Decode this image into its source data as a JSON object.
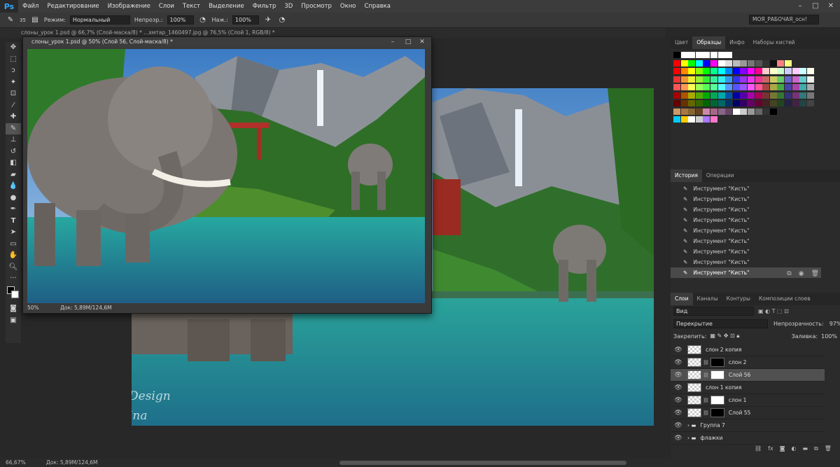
{
  "app": {
    "logo": "Ps"
  },
  "menu": [
    "Файл",
    "Редактирование",
    "Изображение",
    "Слои",
    "Текст",
    "Выделение",
    "Фильтр",
    "3D",
    "Просмотр",
    "Окно",
    "Справка"
  ],
  "workspace": "МОЯ_РАБОЧАЯ_осн!",
  "options": {
    "brush_size": "35",
    "mode_label": "Режим:",
    "mode_value": "Нормальный",
    "opacity_label": "Непрозр.:",
    "opacity_value": "100%",
    "flow_label": "Наж.:",
    "flow_value": "100%"
  },
  "tabs": "слоны_урок 1.psd @ 66,7% (Слой-маска/8) *     ...хмтар_1460497.jpg @ 76,5% (Слой 1, RGB/8) *",
  "float_doc": {
    "title": "слоны_урок 1.psd @ 50% (Слой 56, Слой-маска/8) *",
    "zoom": "50%",
    "doc_size": "Док: 5,89M/124,6M"
  },
  "bg_doc": {
    "watermark1": "Design",
    "watermark2": "ina"
  },
  "swatches_panel": {
    "tabs": [
      "Цвет",
      "Образцы",
      "Инфо",
      "Наборы кистей"
    ],
    "active": "Образцы"
  },
  "history_panel": {
    "tabs": [
      "История",
      "Операции"
    ],
    "items": [
      "Инструмент \"Кисть\"",
      "Инструмент \"Кисть\"",
      "Инструмент \"Кисть\"",
      "Инструмент \"Кисть\"",
      "Инструмент \"Кисть\"",
      "Инструмент \"Кисть\"",
      "Инструмент \"Кисть\"",
      "Инструмент \"Кисть\"",
      "Инструмент \"Кисть\""
    ]
  },
  "layers_panel": {
    "tabs": [
      "Слои",
      "Каналы",
      "Контуры",
      "Композиции слоев"
    ],
    "filter": "Вид",
    "blend": "Перекрытие",
    "opacity_label": "Непрозрачность:",
    "opacity_value": "97%",
    "lock_label": "Закрепить:",
    "fill_label": "Заливка:",
    "fill_value": "100%",
    "layers": [
      {
        "name": "слон 2 копия",
        "mask": "none"
      },
      {
        "name": "слон 2",
        "mask": "black"
      },
      {
        "name": "Слой 56",
        "mask": "white"
      },
      {
        "name": "слон 1 копия",
        "mask": "none"
      },
      {
        "name": "слон 1",
        "mask": "white"
      },
      {
        "name": "Слой 55",
        "mask": "black"
      },
      {
        "name": "Группа 7",
        "mask": "group"
      },
      {
        "name": "флажки",
        "mask": "group"
      }
    ]
  },
  "status": {
    "zoom": "66,67%",
    "doc_size": "Док: 5,89M/124,6M"
  }
}
